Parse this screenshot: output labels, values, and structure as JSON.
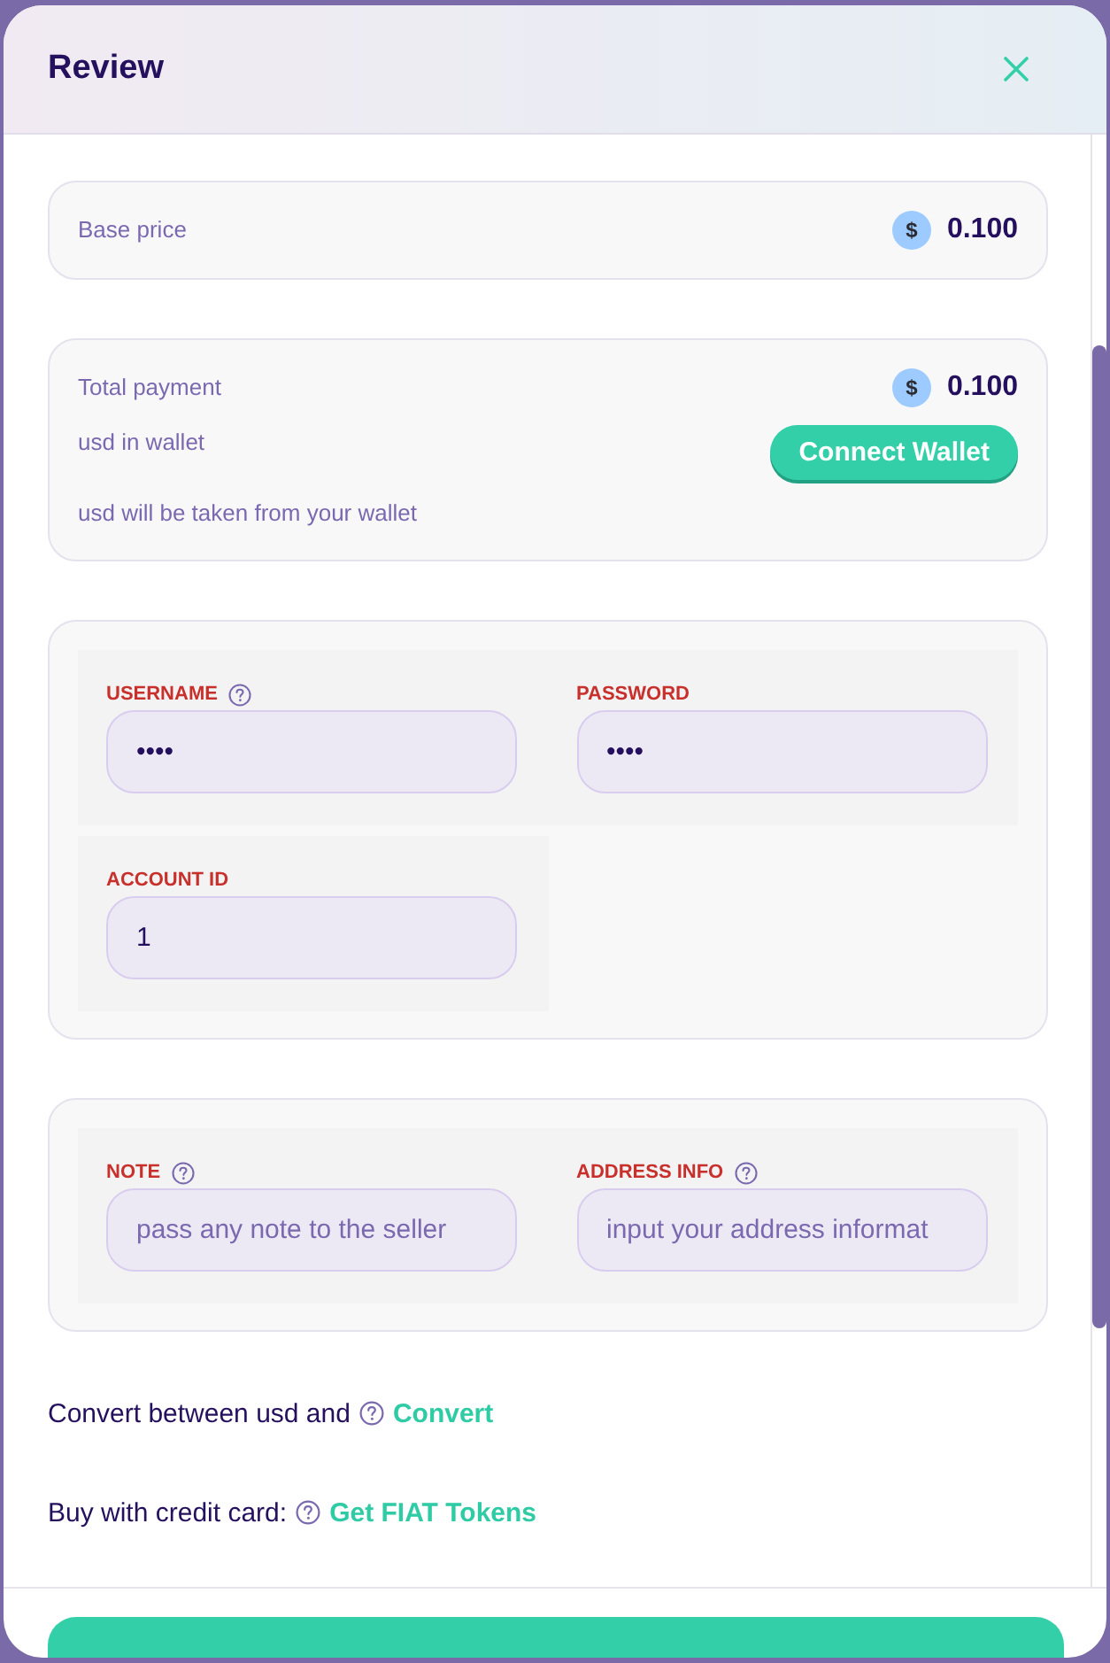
{
  "dialog": {
    "title": "Review"
  },
  "base_price": {
    "label": "Base price",
    "currency_symbol": "$",
    "amount": "0.100"
  },
  "payment": {
    "total_label": "Total payment",
    "currency_symbol": "$",
    "total_amount": "0.100",
    "wallet_label": "usd in wallet",
    "connect_button": "Connect Wallet",
    "note": "usd will be taken from your wallet"
  },
  "account_fields": {
    "rows": [
      [
        {
          "label": "USERNAME",
          "help": true,
          "value": "••••"
        },
        {
          "label": "PASSWORD",
          "help": false,
          "value": "••••"
        }
      ],
      [
        {
          "label": "ACCOUNT ID",
          "help": false,
          "value": "1"
        }
      ]
    ]
  },
  "order_fields": {
    "rows": [
      [
        {
          "label": "NOTE",
          "help": true,
          "placeholder": "pass any note to the seller"
        },
        {
          "label": "ADDRESS INFO",
          "help": true,
          "placeholder": "input your address informat"
        }
      ]
    ]
  },
  "links": [
    {
      "text": "Convert between usd and",
      "link": "Convert"
    },
    {
      "text": "Buy with credit card:",
      "link": "Get FIAT Tokens"
    }
  ]
}
